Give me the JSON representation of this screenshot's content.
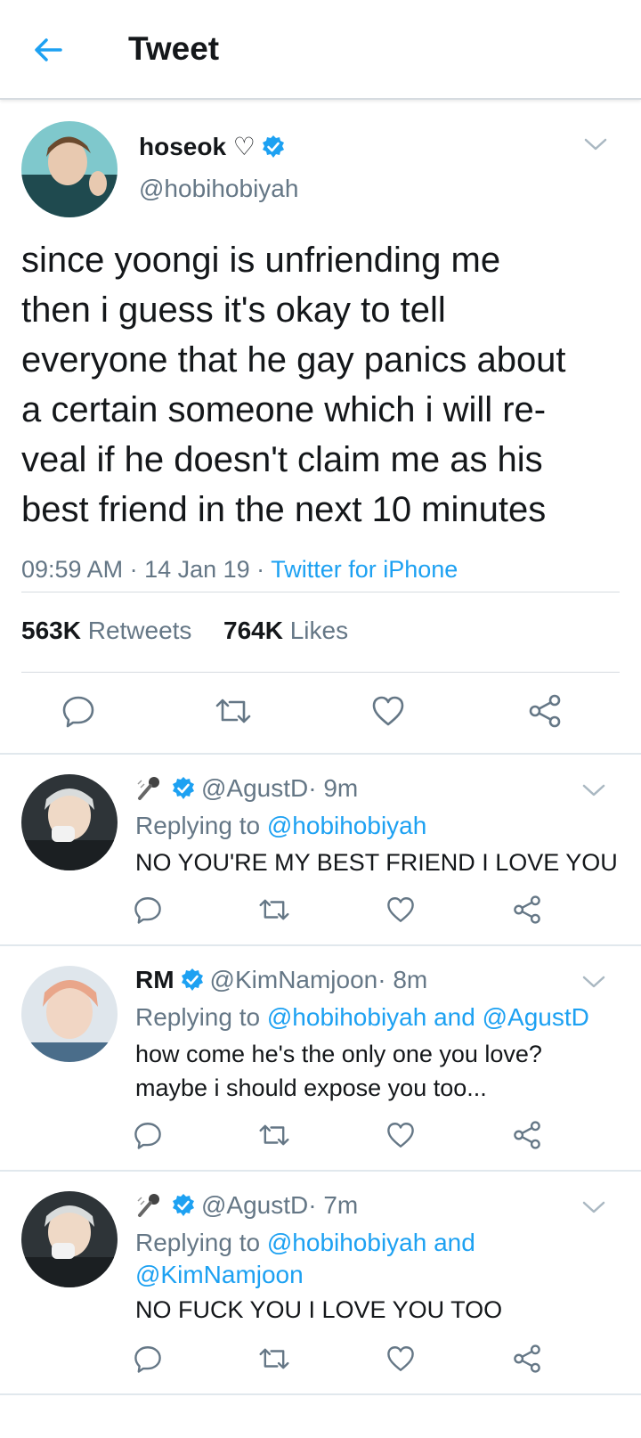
{
  "header": {
    "title": "Tweet"
  },
  "tweet": {
    "name": "hoseok ♡",
    "handle": "@hobihobiyah",
    "text": "since yoongi is unfriending me\nthen i guess it's okay to tell\neveryone that he gay panics about\na certain someone which i will re-\nveal if he doesn't claim me as his\nbest friend in the next 10 minutes",
    "time": "09:59 AM · 14 Jan 19 · ",
    "source": "Twitter for iPhone",
    "retweets_count": "563K",
    "retweets_label": " Retweets",
    "likes_count": "764K",
    "likes_label": " Likes"
  },
  "replies": [
    {
      "name": "",
      "handle": "@AgustD",
      "time": " · 9m",
      "replying_prefix": "Replying to ",
      "replying_mentions": "@hobihobiyah",
      "text": "NO YOU'RE MY BEST FRIEND I LOVE YOU"
    },
    {
      "name": "RM",
      "handle": "@KimNamjoon",
      "time": " · 8m",
      "replying_prefix": "Replying to ",
      "replying_mentions": "@hobihobiyah and @AgustD",
      "text": "how come he's the only one you love?\nmaybe i should expose you too..."
    },
    {
      "name": "",
      "handle": "@AgustD",
      "time": " · 7m",
      "replying_prefix": "Replying to ",
      "replying_mentions": "@hobihobiyah and @KimNamjoon",
      "text": "NO FUCK YOU I LOVE YOU TOO"
    }
  ],
  "icons": {
    "back": "arrow-left-icon",
    "reply": "comment-icon",
    "retweet": "retweet-icon",
    "like": "heart-icon",
    "share": "share-icon",
    "verified": "verified-badge-icon",
    "more": "chevron-down-icon",
    "mic": "microphone-emoji"
  },
  "colors": {
    "accent": "#1da1f2",
    "text": "#14171a",
    "secondary": "#657786"
  }
}
